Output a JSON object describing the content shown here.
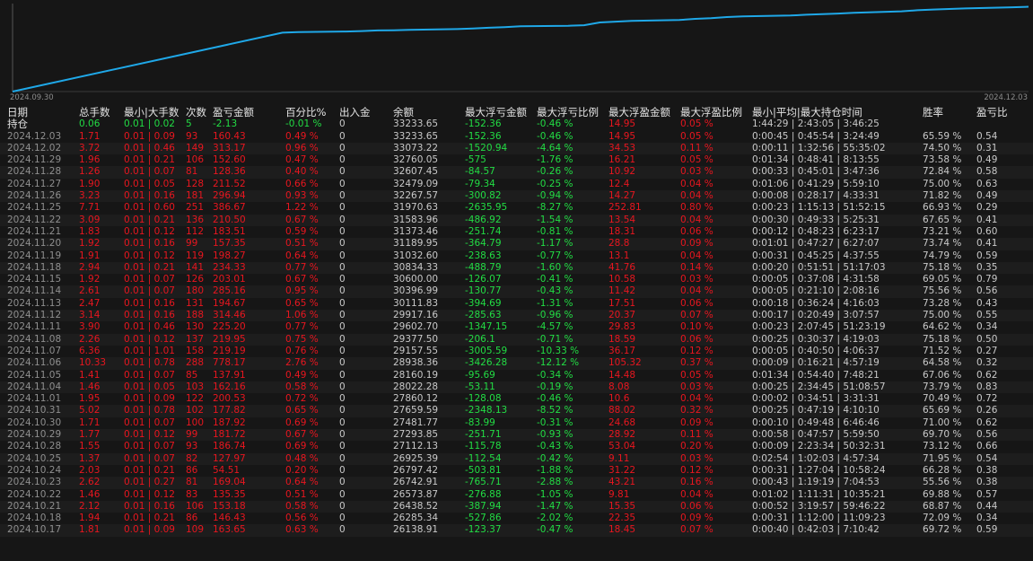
{
  "chart_data": {
    "type": "line",
    "x_start_label": "2024.09.30",
    "x_end_label": "2024.12.03",
    "series_color": "#1fa8e8",
    "x": [
      "2024.09.30",
      "2024.10.17",
      "2024.10.18",
      "2024.10.21",
      "2024.10.22",
      "2024.10.23",
      "2024.10.24",
      "2024.10.25",
      "2024.10.28",
      "2024.10.29",
      "2024.10.30",
      "2024.10.31",
      "2024.11.01",
      "2024.11.04",
      "2024.11.05",
      "2024.11.06",
      "2024.11.07",
      "2024.11.08",
      "2024.11.11",
      "2024.11.12",
      "2024.11.13",
      "2024.11.14",
      "2024.11.15",
      "2024.11.18",
      "2024.11.19",
      "2024.11.20",
      "2024.11.21",
      "2024.11.22",
      "2024.11.25",
      "2024.11.26",
      "2024.11.27",
      "2024.11.28",
      "2024.11.29",
      "2024.12.02",
      "2024.12.03"
    ],
    "values": [
      10000,
      26138.91,
      26285.34,
      26438.52,
      26573.87,
      26742.91,
      26797.42,
      26925.39,
      27112.13,
      27293.85,
      27481.77,
      27659.59,
      27860.12,
      28022.28,
      28160.19,
      28938.36,
      29157.55,
      29377.5,
      29602.7,
      29917.16,
      30111.83,
      30396.99,
      30600.0,
      30834.33,
      31032.6,
      31189.95,
      31373.46,
      31583.96,
      31970.63,
      32267.57,
      32479.09,
      32607.45,
      32760.05,
      33073.22,
      33233.65
    ],
    "ylim": [
      10000,
      33600
    ]
  },
  "headers": {
    "date": "日期",
    "lots": "总手数",
    "minmax": "最小|大手数",
    "count": "次数",
    "pnl": "盈亏金额",
    "pct": "百分比%",
    "io": "出入金",
    "balance": "余额",
    "mfl": "最大浮亏金额",
    "mflp": "最大浮亏比例",
    "mfp": "最大浮盈金额",
    "mfpp": "最大浮盈比例",
    "hold": "最小|平均|最大持仓时间",
    "win": "胜率",
    "ratio": "盈亏比"
  },
  "position_row": {
    "label": "持仓",
    "lots": "0.06",
    "minmax": "0.01 | 0.02",
    "count": "5",
    "pnl": "-2.13",
    "pct": "-0.01 %",
    "io": "0",
    "balance": "33233.65",
    "mfl": "-152.36",
    "mflp": "-0.46 %",
    "mfp": "14.95",
    "mfpp": "0.05 %",
    "hold": "1:44:29 | 2:43:05 | 3:46:25",
    "win": "",
    "ratio": ""
  },
  "rows": [
    {
      "date": "2024.12.03",
      "lots": "1.71",
      "minmax": "0.01 | 0.09",
      "count": "93",
      "pnl": "160.43",
      "pct": "0.49 %",
      "io": "0",
      "balance": "33233.65",
      "mfl": "-152.36",
      "mflp": "-0.46 %",
      "mfp": "14.95",
      "mfpp": "0.05 %",
      "hold": "0:00:45 | 0:45:54 | 3:24:49",
      "win": "65.59 %",
      "ratio": "0.54"
    },
    {
      "date": "2024.12.02",
      "lots": "3.72",
      "minmax": "0.01 | 0.46",
      "count": "149",
      "pnl": "313.17",
      "pct": "0.96 %",
      "io": "0",
      "balance": "33073.22",
      "mfl": "-1520.94",
      "mflp": "-4.64 %",
      "mfp": "34.53",
      "mfpp": "0.11 %",
      "hold": "0:00:11 | 1:32:56 | 55:35:02",
      "win": "74.50 %",
      "ratio": "0.31"
    },
    {
      "date": "2024.11.29",
      "lots": "1.96",
      "minmax": "0.01 | 0.21",
      "count": "106",
      "pnl": "152.60",
      "pct": "0.47 %",
      "io": "0",
      "balance": "32760.05",
      "mfl": "-575",
      "mflp": "-1.76 %",
      "mfp": "16.21",
      "mfpp": "0.05 %",
      "hold": "0:01:34 | 0:48:41 | 8:13:55",
      "win": "73.58 %",
      "ratio": "0.49"
    },
    {
      "date": "2024.11.28",
      "lots": "1.26",
      "minmax": "0.01 | 0.07",
      "count": "81",
      "pnl": "128.36",
      "pct": "0.40 %",
      "io": "0",
      "balance": "32607.45",
      "mfl": "-84.57",
      "mflp": "-0.26 %",
      "mfp": "10.92",
      "mfpp": "0.03 %",
      "hold": "0:00:33 | 0:45:01 | 3:47:36",
      "win": "72.84 %",
      "ratio": "0.58"
    },
    {
      "date": "2024.11.27",
      "lots": "1.90",
      "minmax": "0.01 | 0.05",
      "count": "128",
      "pnl": "211.52",
      "pct": "0.66 %",
      "io": "0",
      "balance": "32479.09",
      "mfl": "-79.34",
      "mflp": "-0.25 %",
      "mfp": "12.4",
      "mfpp": "0.04 %",
      "hold": "0:01:06 | 0:41:29 | 5:59:10",
      "win": "75.00 %",
      "ratio": "0.63"
    },
    {
      "date": "2024.11.26",
      "lots": "3.23",
      "minmax": "0.01 | 0.16",
      "count": "181",
      "pnl": "296.94",
      "pct": "0.93 %",
      "io": "0",
      "balance": "32267.57",
      "mfl": "-300.82",
      "mflp": "-0.94 %",
      "mfp": "14.27",
      "mfpp": "0.04 %",
      "hold": "0:00:08 | 0:28:17 | 4:33:31",
      "win": "71.82 %",
      "ratio": "0.49"
    },
    {
      "date": "2024.11.25",
      "lots": "7.71",
      "minmax": "0.01 | 0.60",
      "count": "251",
      "pnl": "386.67",
      "pct": "1.22 %",
      "io": "0",
      "balance": "31970.63",
      "mfl": "-2635.95",
      "mflp": "-8.27 %",
      "mfp": "252.81",
      "mfpp": "0.80 %",
      "hold": "0:00:23 | 1:15:13 | 51:52:15",
      "win": "66.93 %",
      "ratio": "0.29"
    },
    {
      "date": "2024.11.22",
      "lots": "3.09",
      "minmax": "0.01 | 0.21",
      "count": "136",
      "pnl": "210.50",
      "pct": "0.67 %",
      "io": "0",
      "balance": "31583.96",
      "mfl": "-486.92",
      "mflp": "-1.54 %",
      "mfp": "13.54",
      "mfpp": "0.04 %",
      "hold": "0:00:30 | 0:49:33 | 5:25:31",
      "win": "67.65 %",
      "ratio": "0.41"
    },
    {
      "date": "2024.11.21",
      "lots": "1.83",
      "minmax": "0.01 | 0.12",
      "count": "112",
      "pnl": "183.51",
      "pct": "0.59 %",
      "io": "0",
      "balance": "31373.46",
      "mfl": "-251.74",
      "mflp": "-0.81 %",
      "mfp": "18.31",
      "mfpp": "0.06 %",
      "hold": "0:00:12 | 0:48:23 | 6:23:17",
      "win": "73.21 %",
      "ratio": "0.60"
    },
    {
      "date": "2024.11.20",
      "lots": "1.92",
      "minmax": "0.01 | 0.16",
      "count": "99",
      "pnl": "157.35",
      "pct": "0.51 %",
      "io": "0",
      "balance": "31189.95",
      "mfl": "-364.79",
      "mflp": "-1.17 %",
      "mfp": "28.8",
      "mfpp": "0.09 %",
      "hold": "0:01:01 | 0:47:27 | 6:27:07",
      "win": "73.74 %",
      "ratio": "0.41"
    },
    {
      "date": "2024.11.19",
      "lots": "1.91",
      "minmax": "0.01 | 0.12",
      "count": "119",
      "pnl": "198.27",
      "pct": "0.64 %",
      "io": "0",
      "balance": "31032.60",
      "mfl": "-238.63",
      "mflp": "-0.77 %",
      "mfp": "13.1",
      "mfpp": "0.04 %",
      "hold": "0:00:31 | 0:45:25 | 4:37:55",
      "win": "74.79 %",
      "ratio": "0.59"
    },
    {
      "date": "2024.11.18",
      "lots": "2.94",
      "minmax": "0.01 | 0.21",
      "count": "141",
      "pnl": "234.33",
      "pct": "0.77 %",
      "io": "0",
      "balance": "30834.33",
      "mfl": "-488.79",
      "mflp": "-1.60 %",
      "mfp": "41.76",
      "mfpp": "0.14 %",
      "hold": "0:00:20 | 0:51:51 | 51:17:03",
      "win": "75.18 %",
      "ratio": "0.35"
    },
    {
      "date": "2024.11.15",
      "lots": "1.92",
      "minmax": "0.01 | 0.07",
      "count": "126",
      "pnl": "203.01",
      "pct": "0.67 %",
      "io": "0",
      "balance": "30600.00",
      "mfl": "-126.07",
      "mflp": "-0.41 %",
      "mfp": "10.58",
      "mfpp": "0.03 %",
      "hold": "0:00:05 | 0:37:08 | 4:31:58",
      "win": "69.05 %",
      "ratio": "0.79"
    },
    {
      "date": "2024.11.14",
      "lots": "2.61",
      "minmax": "0.01 | 0.07",
      "count": "180",
      "pnl": "285.16",
      "pct": "0.95 %",
      "io": "0",
      "balance": "30396.99",
      "mfl": "-130.77",
      "mflp": "-0.43 %",
      "mfp": "11.42",
      "mfpp": "0.04 %",
      "hold": "0:00:05 | 0:21:10 | 2:08:16",
      "win": "75.56 %",
      "ratio": "0.56"
    },
    {
      "date": "2024.11.13",
      "lots": "2.47",
      "minmax": "0.01 | 0.16",
      "count": "131",
      "pnl": "194.67",
      "pct": "0.65 %",
      "io": "0",
      "balance": "30111.83",
      "mfl": "-394.69",
      "mflp": "-1.31 %",
      "mfp": "17.51",
      "mfpp": "0.06 %",
      "hold": "0:00:18 | 0:36:24 | 4:16:03",
      "win": "73.28 %",
      "ratio": "0.43"
    },
    {
      "date": "2024.11.12",
      "lots": "3.14",
      "minmax": "0.01 | 0.16",
      "count": "188",
      "pnl": "314.46",
      "pct": "1.06 %",
      "io": "0",
      "balance": "29917.16",
      "mfl": "-285.63",
      "mflp": "-0.96 %",
      "mfp": "20.37",
      "mfpp": "0.07 %",
      "hold": "0:00:17 | 0:20:49 | 3:07:57",
      "win": "75.00 %",
      "ratio": "0.55"
    },
    {
      "date": "2024.11.11",
      "lots": "3.90",
      "minmax": "0.01 | 0.46",
      "count": "130",
      "pnl": "225.20",
      "pct": "0.77 %",
      "io": "0",
      "balance": "29602.70",
      "mfl": "-1347.15",
      "mflp": "-4.57 %",
      "mfp": "29.83",
      "mfpp": "0.10 %",
      "hold": "0:00:23 | 2:07:45 | 51:23:19",
      "win": "64.62 %",
      "ratio": "0.34"
    },
    {
      "date": "2024.11.08",
      "lots": "2.26",
      "minmax": "0.01 | 0.12",
      "count": "137",
      "pnl": "219.95",
      "pct": "0.75 %",
      "io": "0",
      "balance": "29377.50",
      "mfl": "-206.1",
      "mflp": "-0.71 %",
      "mfp": "18.59",
      "mfpp": "0.06 %",
      "hold": "0:00:25 | 0:30:37 | 4:19:03",
      "win": "75.18 %",
      "ratio": "0.50"
    },
    {
      "date": "2024.11.07",
      "lots": "6.36",
      "minmax": "0.01 | 1.01",
      "count": "158",
      "pnl": "219.19",
      "pct": "0.76 %",
      "io": "0",
      "balance": "29157.55",
      "mfl": "-3005.59",
      "mflp": "-10.33 %",
      "mfp": "36.17",
      "mfpp": "0.12 %",
      "hold": "0:00:05 | 0:40:50 | 4:06:37",
      "win": "71.52 %",
      "ratio": "0.27"
    },
    {
      "date": "2024.11.06",
      "lots": "10.33",
      "minmax": "0.01 | 0.78",
      "count": "288",
      "pnl": "778.17",
      "pct": "2.76 %",
      "io": "0",
      "balance": "28938.36",
      "mfl": "-3426.28",
      "mflp": "-12.12 %",
      "mfp": "105.32",
      "mfpp": "0.37 %",
      "hold": "0:00:09 | 0:16:21 | 4:57:19",
      "win": "64.58 %",
      "ratio": "0.32"
    },
    {
      "date": "2024.11.05",
      "lots": "1.41",
      "minmax": "0.01 | 0.07",
      "count": "85",
      "pnl": "137.91",
      "pct": "0.49 %",
      "io": "0",
      "balance": "28160.19",
      "mfl": "-95.69",
      "mflp": "-0.34 %",
      "mfp": "14.48",
      "mfpp": "0.05 %",
      "hold": "0:01:34 | 0:54:40 | 7:48:21",
      "win": "67.06 %",
      "ratio": "0.62"
    },
    {
      "date": "2024.11.04",
      "lots": "1.46",
      "minmax": "0.01 | 0.05",
      "count": "103",
      "pnl": "162.16",
      "pct": "0.58 %",
      "io": "0",
      "balance": "28022.28",
      "mfl": "-53.11",
      "mflp": "-0.19 %",
      "mfp": "8.08",
      "mfpp": "0.03 %",
      "hold": "0:00:25 | 2:34:45 | 51:08:57",
      "win": "73.79 %",
      "ratio": "0.83"
    },
    {
      "date": "2024.11.01",
      "lots": "1.95",
      "minmax": "0.01 | 0.09",
      "count": "122",
      "pnl": "200.53",
      "pct": "0.72 %",
      "io": "0",
      "balance": "27860.12",
      "mfl": "-128.08",
      "mflp": "-0.46 %",
      "mfp": "10.6",
      "mfpp": "0.04 %",
      "hold": "0:00:02 | 0:34:51 | 3:31:31",
      "win": "70.49 %",
      "ratio": "0.72"
    },
    {
      "date": "2024.10.31",
      "lots": "5.02",
      "minmax": "0.01 | 0.78",
      "count": "102",
      "pnl": "177.82",
      "pct": "0.65 %",
      "io": "0",
      "balance": "27659.59",
      "mfl": "-2348.13",
      "mflp": "-8.52 %",
      "mfp": "88.02",
      "mfpp": "0.32 %",
      "hold": "0:00:25 | 0:47:19 | 4:10:10",
      "win": "65.69 %",
      "ratio": "0.26"
    },
    {
      "date": "2024.10.30",
      "lots": "1.71",
      "minmax": "0.01 | 0.07",
      "count": "100",
      "pnl": "187.92",
      "pct": "0.69 %",
      "io": "0",
      "balance": "27481.77",
      "mfl": "-83.99",
      "mflp": "-0.31 %",
      "mfp": "24.68",
      "mfpp": "0.09 %",
      "hold": "0:00:10 | 0:49:48 | 6:46:46",
      "win": "71.00 %",
      "ratio": "0.62"
    },
    {
      "date": "2024.10.29",
      "lots": "1.77",
      "minmax": "0.01 | 0.12",
      "count": "99",
      "pnl": "181.72",
      "pct": "0.67 %",
      "io": "0",
      "balance": "27293.85",
      "mfl": "-251.71",
      "mflp": "-0.93 %",
      "mfp": "28.92",
      "mfpp": "0.11 %",
      "hold": "0:00:58 | 0:47:57 | 5:59:50",
      "win": "69.70 %",
      "ratio": "0.56"
    },
    {
      "date": "2024.10.28",
      "lots": "1.55",
      "minmax": "0.01 | 0.07",
      "count": "93",
      "pnl": "186.74",
      "pct": "0.69 %",
      "io": "0",
      "balance": "27112.13",
      "mfl": "-115.78",
      "mflp": "-0.43 %",
      "mfp": "53.04",
      "mfpp": "0.20 %",
      "hold": "0:00:09 | 2:23:34 | 50:32:31",
      "win": "73.12 %",
      "ratio": "0.66"
    },
    {
      "date": "2024.10.25",
      "lots": "1.37",
      "minmax": "0.01 | 0.07",
      "count": "82",
      "pnl": "127.97",
      "pct": "0.48 %",
      "io": "0",
      "balance": "26925.39",
      "mfl": "-112.54",
      "mflp": "-0.42 %",
      "mfp": "9.11",
      "mfpp": "0.03 %",
      "hold": "0:02:54 | 1:02:03 | 4:57:34",
      "win": "71.95 %",
      "ratio": "0.54"
    },
    {
      "date": "2024.10.24",
      "lots": "2.03",
      "minmax": "0.01 | 0.21",
      "count": "86",
      "pnl": "54.51",
      "pct": "0.20 %",
      "io": "0",
      "balance": "26797.42",
      "mfl": "-503.81",
      "mflp": "-1.88 %",
      "mfp": "31.22",
      "mfpp": "0.12 %",
      "hold": "0:00:31 | 1:27:04 | 10:58:24",
      "win": "66.28 %",
      "ratio": "0.38"
    },
    {
      "date": "2024.10.23",
      "lots": "2.62",
      "minmax": "0.01 | 0.27",
      "count": "81",
      "pnl": "169.04",
      "pct": "0.64 %",
      "io": "0",
      "balance": "26742.91",
      "mfl": "-765.71",
      "mflp": "-2.88 %",
      "mfp": "43.21",
      "mfpp": "0.16 %",
      "hold": "0:00:43 | 1:19:19 | 7:04:53",
      "win": "55.56 %",
      "ratio": "0.38"
    },
    {
      "date": "2024.10.22",
      "lots": "1.46",
      "minmax": "0.01 | 0.12",
      "count": "83",
      "pnl": "135.35",
      "pct": "0.51 %",
      "io": "0",
      "balance": "26573.87",
      "mfl": "-276.88",
      "mflp": "-1.05 %",
      "mfp": "9.81",
      "mfpp": "0.04 %",
      "hold": "0:01:02 | 1:11:31 | 10:35:21",
      "win": "69.88 %",
      "ratio": "0.57"
    },
    {
      "date": "2024.10.21",
      "lots": "2.12",
      "minmax": "0.01 | 0.16",
      "count": "106",
      "pnl": "153.18",
      "pct": "0.58 %",
      "io": "0",
      "balance": "26438.52",
      "mfl": "-387.94",
      "mflp": "-1.47 %",
      "mfp": "15.35",
      "mfpp": "0.06 %",
      "hold": "0:00:52 | 3:19:57 | 59:46:22",
      "win": "68.87 %",
      "ratio": "0.44"
    },
    {
      "date": "2024.10.18",
      "lots": "1.94",
      "minmax": "0.01 | 0.21",
      "count": "86",
      "pnl": "146.43",
      "pct": "0.56 %",
      "io": "0",
      "balance": "26285.34",
      "mfl": "-527.86",
      "mflp": "-2.02 %",
      "mfp": "22.35",
      "mfpp": "0.09 %",
      "hold": "0:00:31 | 1:12:00 | 11:09:23",
      "win": "72.09 %",
      "ratio": "0.34"
    },
    {
      "date": "2024.10.17",
      "lots": "1.81",
      "minmax": "0.01 | 0.09",
      "count": "109",
      "pnl": "163.65",
      "pct": "0.63 %",
      "io": "0",
      "balance": "26138.91",
      "mfl": "-123.37",
      "mflp": "-0.47 %",
      "mfp": "18.45",
      "mfpp": "0.07 %",
      "hold": "0:00:40 | 0:42:03 | 7:10:42",
      "win": "69.72 %",
      "ratio": "0.59"
    }
  ]
}
